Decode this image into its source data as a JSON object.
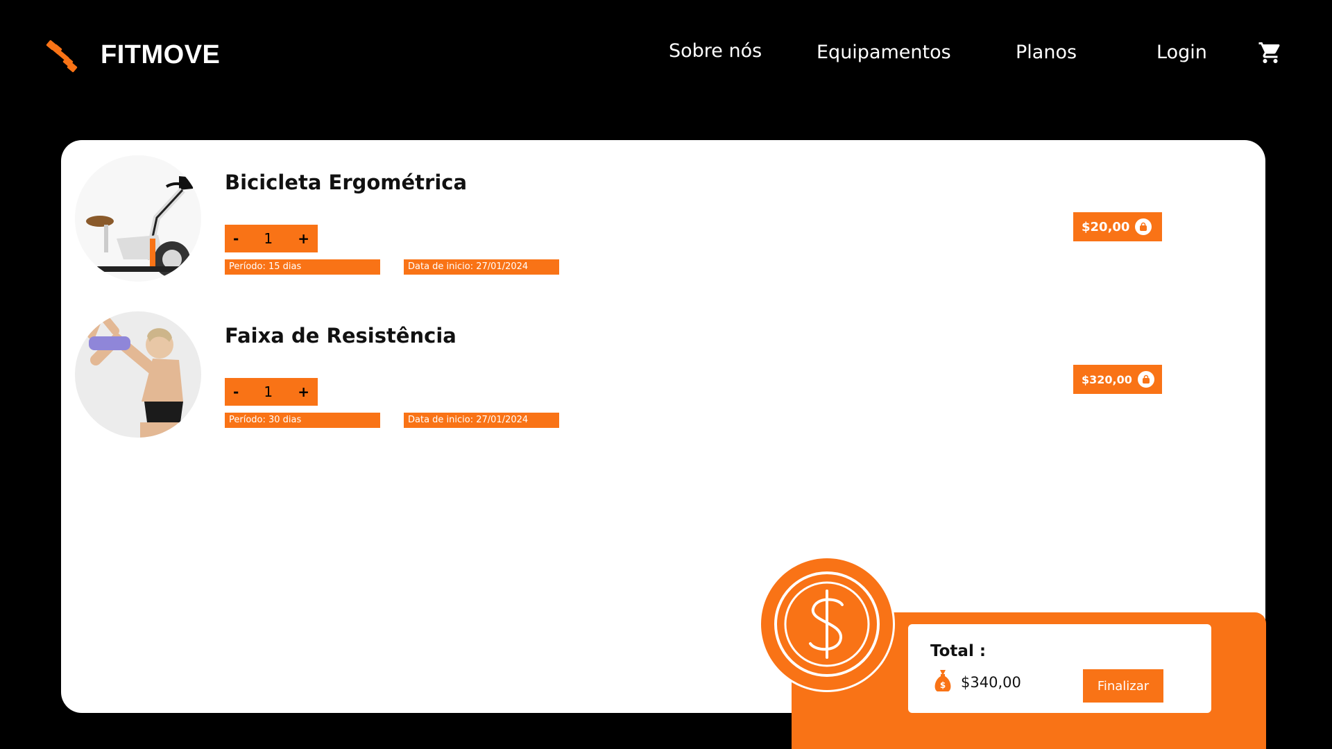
{
  "header": {
    "brand": "FITMOVE",
    "nav": [
      "Sobre nós",
      "Equipamentos",
      "Planos",
      "Login"
    ],
    "logo_icon": "dumbbell-icon",
    "cart_icon": "cart-icon"
  },
  "cart": {
    "items": [
      {
        "title": "Bicicleta Ergométrica",
        "image": "exercise-bike",
        "quantity": "1",
        "minus": "-",
        "plus": "+",
        "period": "Período:  15 dias",
        "start_date": "Data de inicio: 27/01/2024",
        "price": "$20,00",
        "price_icon": "bag-icon"
      },
      {
        "title": "Faixa de Resistência",
        "image": "resistance-band-woman",
        "quantity": "1",
        "minus": "-",
        "plus": "+",
        "period": "Período:  30 dias",
        "start_date": "Data de inicio: 27/01/2024",
        "price": "$320,00",
        "price_icon": "bag-icon"
      }
    ]
  },
  "summary": {
    "total_label": "Total :",
    "total_value": "$340,00",
    "finalize_label": "Finalizar",
    "coin_icon": "dollar-coin-icon",
    "money_icon": "money-bag-icon"
  },
  "colors": {
    "accent": "#f97316",
    "background": "#000000",
    "card": "#ffffff"
  }
}
